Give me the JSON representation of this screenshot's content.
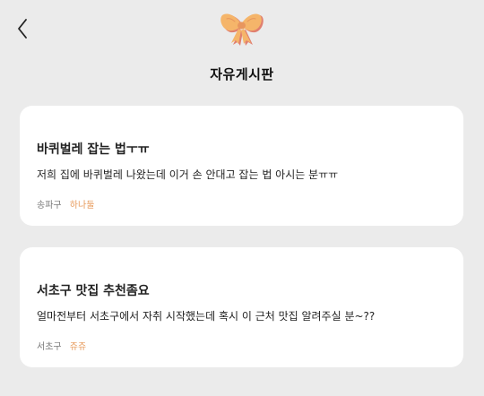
{
  "header": {
    "back_icon": "chevron-left-icon",
    "logo_icon": "ribbon-bow-icon",
    "title": "자유게시판"
  },
  "colors": {
    "background": "#ebebeb",
    "card": "#ffffff",
    "author_accent": "#e79a5a",
    "bow_main": "#f5b56a",
    "bow_shadow": "#e07f6f"
  },
  "posts": [
    {
      "title": "바퀴벌레 잡는 법ㅜㅠ",
      "body": "저희 집에 바퀴벌레 나왔는데 이거 손 안대고 잡는 법 아시는 분ㅠㅠ",
      "location": "송파구",
      "author": "하나둘"
    },
    {
      "title": "서초구 맛집 추천좀요",
      "body": "얼마전부터 서초구에서 자취 시작했는데 혹시 이 근처 맛집 알려주실 분~??",
      "location": "서초구",
      "author": "쥬쥬"
    }
  ]
}
